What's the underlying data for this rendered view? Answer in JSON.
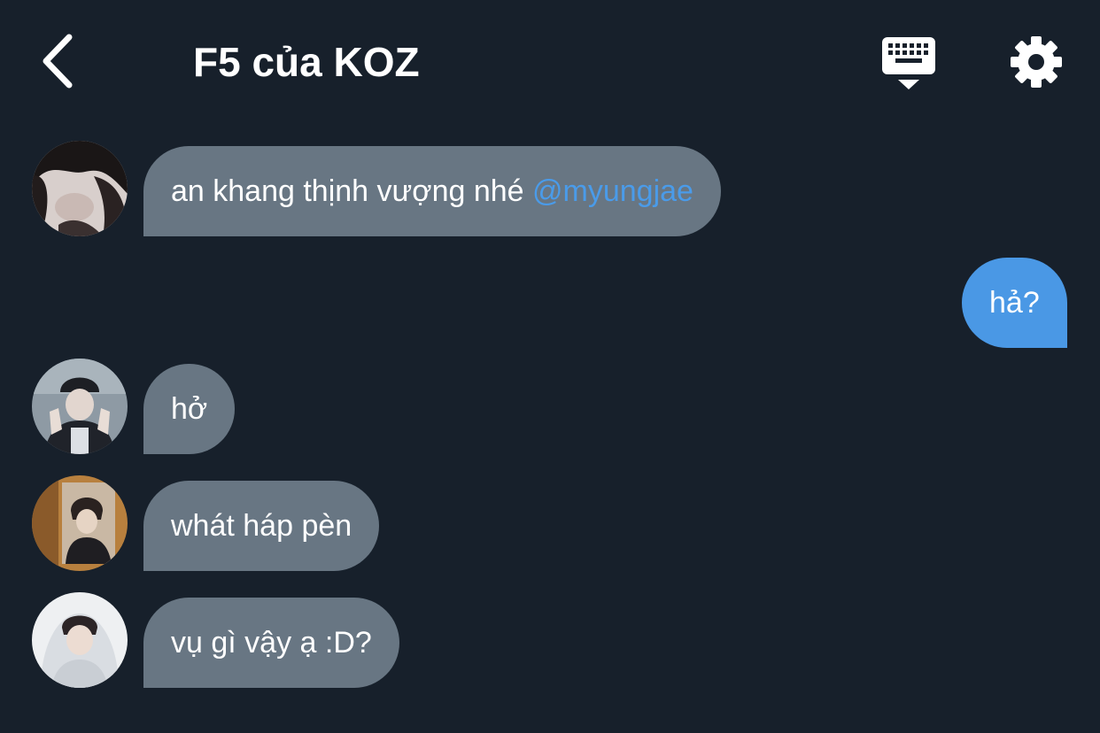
{
  "header": {
    "title": "F5 của KOZ"
  },
  "messages": [
    {
      "direction": "incoming",
      "text": "an khang thịnh vượng nhé ",
      "mention": "@myungjae",
      "avatar": "avatar-photo-dark-hair"
    },
    {
      "direction": "outgoing",
      "text": "hả?"
    },
    {
      "direction": "incoming",
      "text": "hở",
      "avatar": "avatar-photo-beanie"
    },
    {
      "direction": "incoming",
      "text": "whát háp pèn",
      "avatar": "avatar-photo-mirror"
    },
    {
      "direction": "incoming",
      "text": "vụ gì vậy ạ :D?",
      "avatar": "avatar-photo-hoodie"
    }
  ],
  "colors": {
    "background": "#17202b",
    "incoming_bubble": "#687683",
    "outgoing_bubble": "#4a98e5",
    "mention": "#4a9be9",
    "text": "#ffffff"
  },
  "icons": {
    "back": "chevron-left-icon",
    "keyboard": "keyboard-icon",
    "settings": "gear-icon"
  }
}
